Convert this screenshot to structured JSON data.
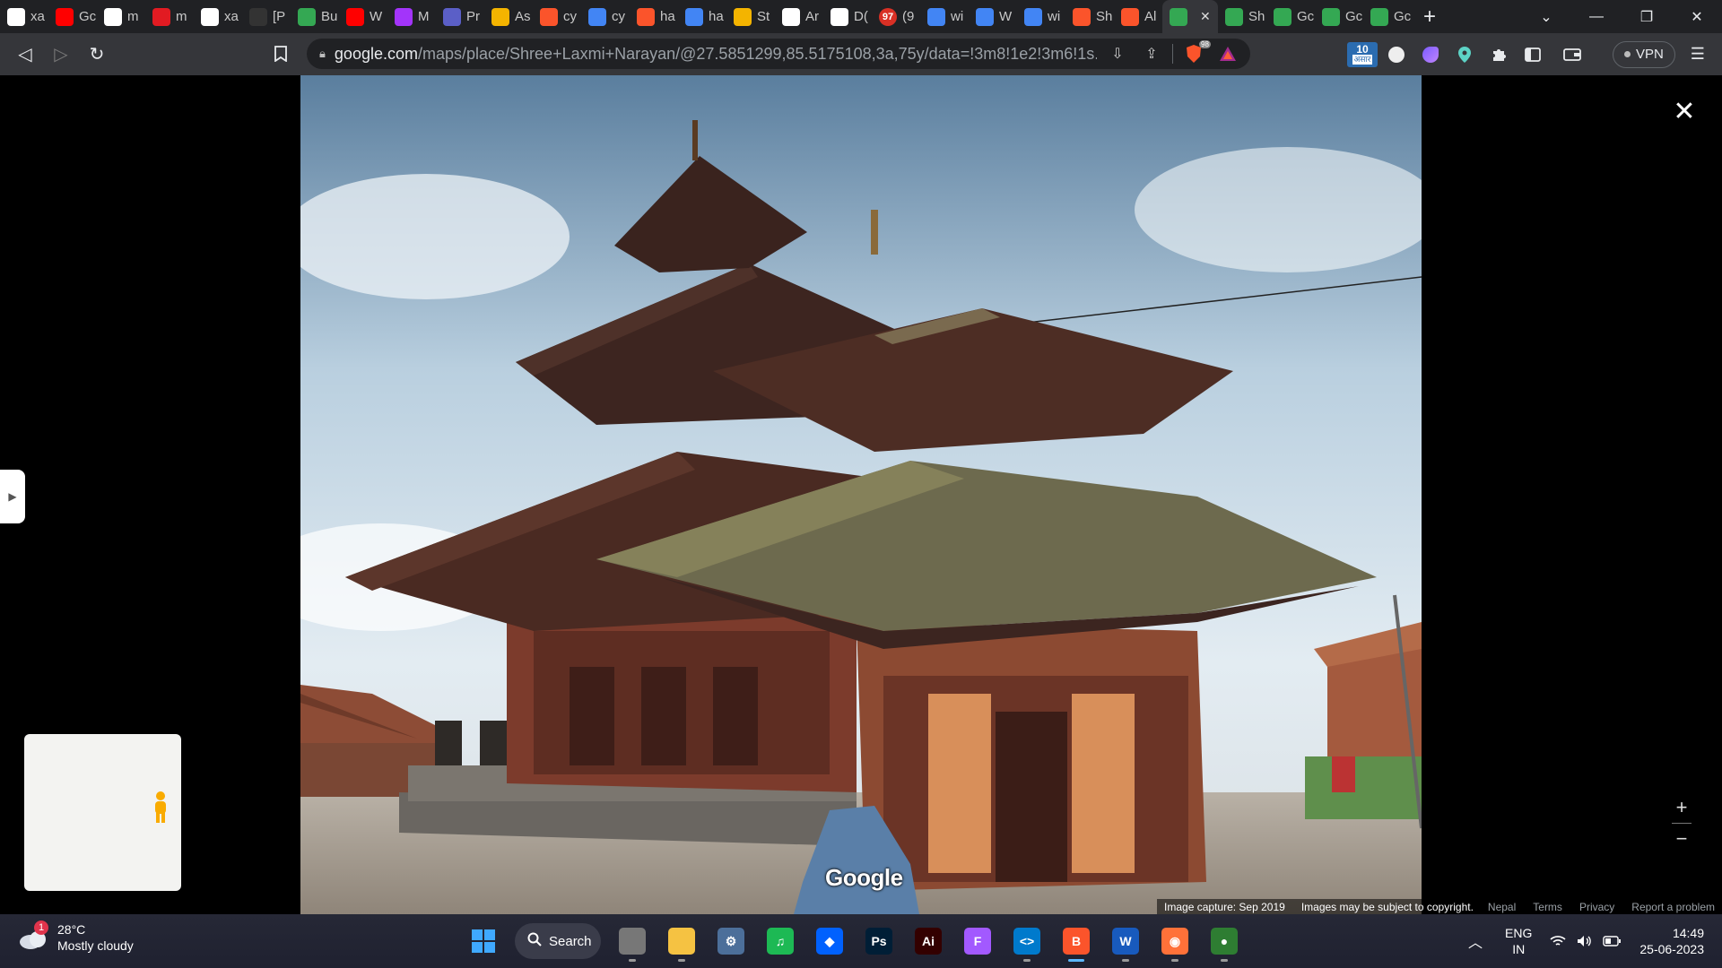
{
  "browser": {
    "tabs": [
      {
        "label": "xa",
        "icon": "github-icon",
        "color": "#ffffff"
      },
      {
        "label": "Gc",
        "icon": "youtube-icon",
        "color": "#ff0000"
      },
      {
        "label": "m",
        "icon": "github-icon",
        "color": "#ffffff"
      },
      {
        "label": "m",
        "icon": "news-icon",
        "color": "#e21b22"
      },
      {
        "label": "xa",
        "icon": "github-icon",
        "color": "#ffffff"
      },
      {
        "label": "[P",
        "icon": "openai-icon",
        "color": "#333333"
      },
      {
        "label": "Bu",
        "icon": "drive-icon",
        "color": "#34a853"
      },
      {
        "label": "W",
        "icon": "youtube-icon",
        "color": "#ff0000"
      },
      {
        "label": "M",
        "icon": "messenger-icon",
        "color": "#a334fa"
      },
      {
        "label": "Pr",
        "icon": "teams-icon",
        "color": "#5b5fc7"
      },
      {
        "label": "As",
        "icon": "classroom-icon",
        "color": "#f4b400"
      },
      {
        "label": "cy",
        "icon": "brave-icon",
        "color": "#fb542b"
      },
      {
        "label": "cy",
        "icon": "google-icon",
        "color": "#4285f4"
      },
      {
        "label": "ha",
        "icon": "brave-icon",
        "color": "#fb542b"
      },
      {
        "label": "ha",
        "icon": "google-icon",
        "color": "#4285f4"
      },
      {
        "label": "St",
        "icon": "classroom-icon",
        "color": "#f4b400"
      },
      {
        "label": "Ar",
        "icon": "medium-icon",
        "color": "#ffffff"
      },
      {
        "label": "D(",
        "icon": "doc-icon",
        "color": "#ffffff"
      },
      {
        "label": "(9",
        "icon": "badge-icon",
        "color": "#d93025"
      },
      {
        "label": "wi",
        "icon": "docs-icon",
        "color": "#4285f4"
      },
      {
        "label": "W",
        "icon": "docs-icon",
        "color": "#4285f4"
      },
      {
        "label": "wi",
        "icon": "docs-icon",
        "color": "#4285f4"
      },
      {
        "label": "Sh",
        "icon": "brave-icon",
        "color": "#fb542b"
      },
      {
        "label": "Al",
        "icon": "brave-icon",
        "color": "#fb542b"
      },
      {
        "label": "",
        "icon": "maps-icon",
        "color": "#34a853",
        "active": true
      },
      {
        "label": "Sh",
        "icon": "maps-icon",
        "color": "#34a853"
      },
      {
        "label": "Gc",
        "icon": "maps-icon",
        "color": "#34a853"
      },
      {
        "label": "Gc",
        "icon": "maps-icon",
        "color": "#34a853"
      },
      {
        "label": "Gc",
        "icon": "maps-icon",
        "color": "#34a853"
      }
    ],
    "badge_97": "97",
    "url_host": "google.com",
    "url_path": "/maps/place/Shree+Laxmi+Narayan/@27.5851299,85.5175108,3a,75y/data=!3m8!1e2!3m6!1s...",
    "calendar_badge": "10",
    "calendar_badge_sub": "असार",
    "brave_badge": "98",
    "vpn_label": "VPN"
  },
  "viewer": {
    "google_logo": "Google",
    "image_capture": "Image capture: Sep 2019",
    "copyright": "Images may be subject to copyright.",
    "footer_links": [
      "Nepal",
      "Terms",
      "Privacy",
      "Report a problem"
    ],
    "zoom_in": "+",
    "zoom_out": "−"
  },
  "taskbar": {
    "weather_temp": "28°C",
    "weather_desc": "Mostly cloudy",
    "weather_badge": "1",
    "search_label": "Search",
    "apps": [
      {
        "name": "windows-start",
        "glyph": "",
        "color": "#2b8cff"
      },
      {
        "name": "task-view",
        "glyph": "",
        "color": "#777777"
      },
      {
        "name": "file-explorer",
        "glyph": "",
        "color": "#f5c242"
      },
      {
        "name": "settings",
        "glyph": "⚙",
        "color": "#4c6f9a"
      },
      {
        "name": "spotify",
        "glyph": "♫",
        "color": "#1db954"
      },
      {
        "name": "dropbox",
        "glyph": "◆",
        "color": "#0061fe"
      },
      {
        "name": "photoshop",
        "glyph": "Ps",
        "color": "#001e36"
      },
      {
        "name": "illustrator",
        "glyph": "Ai",
        "color": "#330000"
      },
      {
        "name": "figma",
        "glyph": "F",
        "color": "#a259ff"
      },
      {
        "name": "vscode",
        "glyph": "<>",
        "color": "#007acc"
      },
      {
        "name": "brave",
        "glyph": "B",
        "color": "#fb542b"
      },
      {
        "name": "word",
        "glyph": "W",
        "color": "#185abd"
      },
      {
        "name": "firefox",
        "glyph": "◉",
        "color": "#ff7139"
      },
      {
        "name": "app-green",
        "glyph": "●",
        "color": "#2e7d32"
      }
    ],
    "lang_line1": "ENG",
    "lang_line2": "IN",
    "time": "14:49",
    "date": "25-06-2023"
  }
}
